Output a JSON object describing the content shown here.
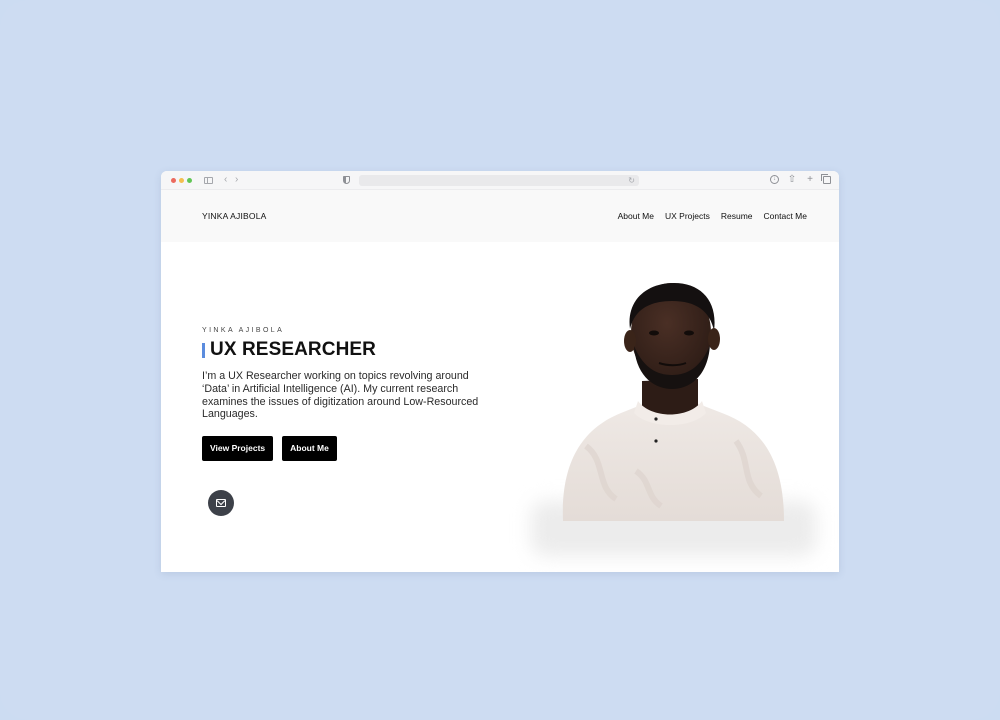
{
  "site": {
    "logo": "YINKA AJIBOLA",
    "nav": [
      "About Me",
      "UX Projects",
      "Resume",
      "Contact Me"
    ]
  },
  "hero": {
    "eyebrow": "YINKA AJIBOLA",
    "title": "UX RESEARCHER",
    "intro": "I’m a UX Researcher working on topics revolving around ‘Data’ in Artificial Intelligence (AI). My current research examines the issues of digitization around Low-Resourced Languages.",
    "buttons": {
      "view_projects": "View Projects",
      "about_me": "About Me"
    },
    "icons": {
      "mail": "mail-icon",
      "accent_color": "#5b8cde"
    }
  },
  "browser": {
    "icons": [
      "sidebar-icon",
      "back-icon",
      "forward-icon",
      "shield-icon",
      "reload-icon",
      "download-icon",
      "share-icon",
      "new-tab-icon",
      "tabs-icon"
    ]
  },
  "colors": {
    "background": "#cddcf2",
    "button": "#000000",
    "mail_button": "#3d4149"
  }
}
